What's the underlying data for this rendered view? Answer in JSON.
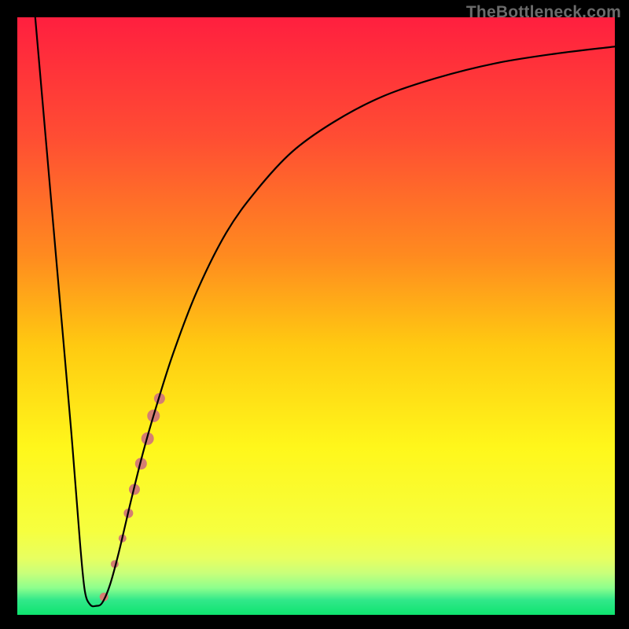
{
  "watermark": "TheBottleneck.com",
  "chart_data": {
    "type": "line",
    "title": "",
    "xlabel": "",
    "ylabel": "",
    "xlim": [
      0,
      100
    ],
    "ylim": [
      0,
      100
    ],
    "grid": false,
    "legend": false,
    "gradient_stops": [
      {
        "offset": 0.0,
        "color": "#ff1f3f"
      },
      {
        "offset": 0.2,
        "color": "#ff4d33"
      },
      {
        "offset": 0.4,
        "color": "#ff8b1f"
      },
      {
        "offset": 0.55,
        "color": "#ffca11"
      },
      {
        "offset": 0.72,
        "color": "#fff71b"
      },
      {
        "offset": 0.86,
        "color": "#f6ff3f"
      },
      {
        "offset": 0.905,
        "color": "#e8ff60"
      },
      {
        "offset": 0.93,
        "color": "#c9ff7a"
      },
      {
        "offset": 0.955,
        "color": "#8dff8d"
      },
      {
        "offset": 0.975,
        "color": "#32e88a"
      },
      {
        "offset": 1.0,
        "color": "#0ee46f"
      }
    ],
    "series": [
      {
        "name": "curve",
        "stroke": "#000000",
        "stroke_width": 2.2,
        "points": [
          {
            "x": 3.0,
            "y": 100.0
          },
          {
            "x": 5.0,
            "y": 77.0
          },
          {
            "x": 7.0,
            "y": 54.0
          },
          {
            "x": 9.0,
            "y": 31.0
          },
          {
            "x": 10.5,
            "y": 12.0
          },
          {
            "x": 11.3,
            "y": 4.0
          },
          {
            "x": 12.2,
            "y": 1.7
          },
          {
            "x": 13.2,
            "y": 1.5
          },
          {
            "x": 14.2,
            "y": 2.0
          },
          {
            "x": 15.5,
            "y": 5.0
          },
          {
            "x": 17.0,
            "y": 10.5
          },
          {
            "x": 19.0,
            "y": 19.0
          },
          {
            "x": 21.0,
            "y": 27.0
          },
          {
            "x": 23.0,
            "y": 34.0
          },
          {
            "x": 26.0,
            "y": 43.5
          },
          {
            "x": 30.0,
            "y": 54.0
          },
          {
            "x": 35.0,
            "y": 64.0
          },
          {
            "x": 40.0,
            "y": 71.0
          },
          {
            "x": 46.0,
            "y": 77.5
          },
          {
            "x": 53.0,
            "y": 82.5
          },
          {
            "x": 61.0,
            "y": 86.7
          },
          {
            "x": 70.0,
            "y": 89.8
          },
          {
            "x": 80.0,
            "y": 92.3
          },
          {
            "x": 90.0,
            "y": 93.9
          },
          {
            "x": 100.0,
            "y": 95.1
          }
        ]
      }
    ],
    "markers": {
      "name": "highlight-dots",
      "fill": "#d47e72",
      "points": [
        {
          "x": 14.5,
          "y": 3.0,
          "r": 5.5
        },
        {
          "x": 16.3,
          "y": 8.5,
          "r": 5.0
        },
        {
          "x": 17.6,
          "y": 12.8,
          "r": 5.0
        },
        {
          "x": 18.6,
          "y": 17.0,
          "r": 6.0
        },
        {
          "x": 19.6,
          "y": 21.0,
          "r": 7.0
        },
        {
          "x": 20.7,
          "y": 25.3,
          "r": 7.5
        },
        {
          "x": 21.8,
          "y": 29.5,
          "r": 8.0
        },
        {
          "x": 22.8,
          "y": 33.3,
          "r": 8.0
        },
        {
          "x": 23.8,
          "y": 36.2,
          "r": 7.0
        }
      ]
    }
  }
}
